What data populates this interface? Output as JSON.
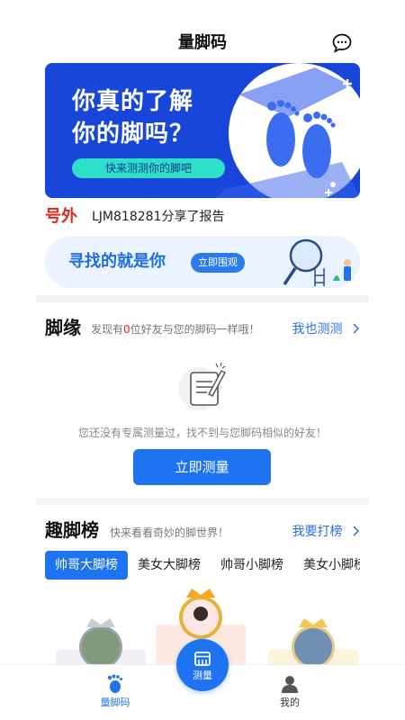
{
  "header": {
    "title": "量脚码",
    "chat_icon": "chat-bubble-icon"
  },
  "banner": {
    "line1": "你真的了解",
    "line2": "你的脚吗？",
    "pill": "快来测测你的脚吧",
    "colors": {
      "bg": "#1746d8",
      "accent": "#2ee0c9"
    }
  },
  "notice": {
    "logo": "号外",
    "message": "LJM818281分享了报告"
  },
  "promo": {
    "text": "寻找的就是你",
    "button": "立即围观"
  },
  "foot_match": {
    "title": "脚缘",
    "subtitle_prefix": "发现有",
    "subtitle_count": "0",
    "subtitle_suffix": "位好友与您的脚码一样哦！",
    "link": "我也测测",
    "empty_text": "您还没有专属测量过，找不到与您脚码相似的好友！",
    "button": "立即测量"
  },
  "ranking": {
    "title": "趣脚榜",
    "subtitle": "快来看看奇妙的脚世界！",
    "link": "我要打榜",
    "tabs": [
      "帅哥大脚榜",
      "美女大脚榜",
      "帅哥小脚榜",
      "美女小脚榜"
    ],
    "active_tab": 0
  },
  "tabbar": {
    "home": "量脚码",
    "center": "测量",
    "mine": "我的"
  },
  "colors": {
    "primary": "#1e74f0",
    "highlight": "#e0281e"
  }
}
